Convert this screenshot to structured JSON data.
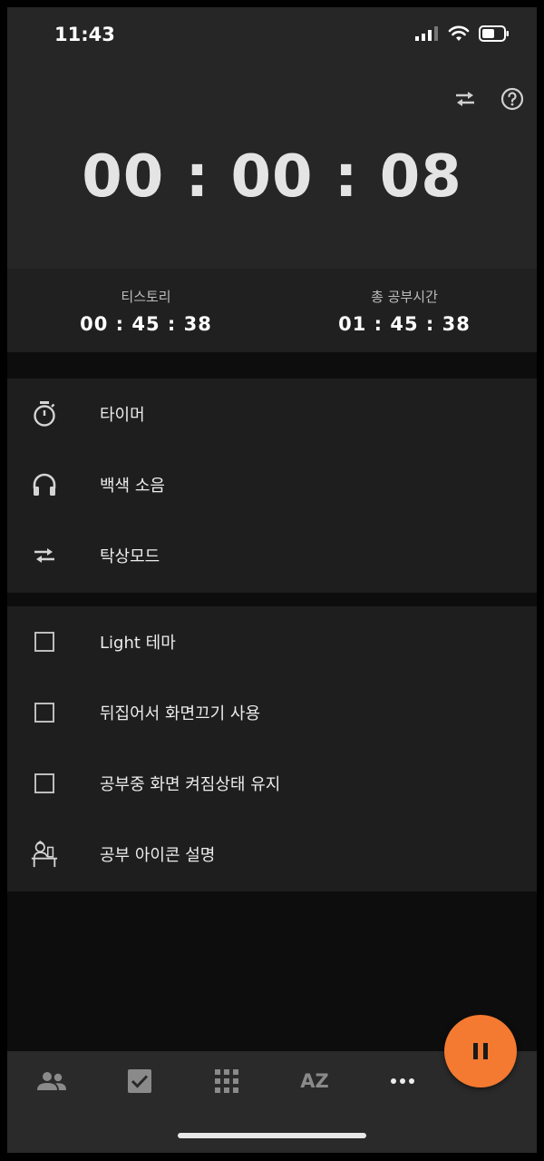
{
  "status_bar": {
    "time": "11:43"
  },
  "timer": {
    "display": "00 : 00 : 08"
  },
  "stats": [
    {
      "label": "티스토리",
      "value": "00 : 45 : 38"
    },
    {
      "label": "총 공부시간",
      "value": "01 : 45 : 38"
    }
  ],
  "menu": [
    {
      "label": "타이머",
      "icon": "stopwatch-icon"
    },
    {
      "label": "백색 소음",
      "icon": "headphones-icon"
    },
    {
      "label": "탁상모드",
      "icon": "swap-arrows-icon"
    }
  ],
  "settings": [
    {
      "label": "Light 테마",
      "checked": false
    },
    {
      "label": "뒤집어서 화면끄기 사용",
      "checked": false
    },
    {
      "label": "공부중 화면 켜짐상태 유지",
      "checked": false
    },
    {
      "label": "공부 아이콘 설명",
      "icon": "study-person-icon"
    }
  ],
  "bottom_nav": [
    {
      "icon": "people-icon"
    },
    {
      "icon": "checkbox-checked-icon"
    },
    {
      "icon": "grid-icon"
    },
    {
      "icon": "az-sort-icon",
      "text": "AZ"
    },
    {
      "icon": "more-icon"
    }
  ],
  "colors": {
    "accent": "#f37a30",
    "background": "#0d0d0d",
    "panel": "#1e1e1e"
  }
}
